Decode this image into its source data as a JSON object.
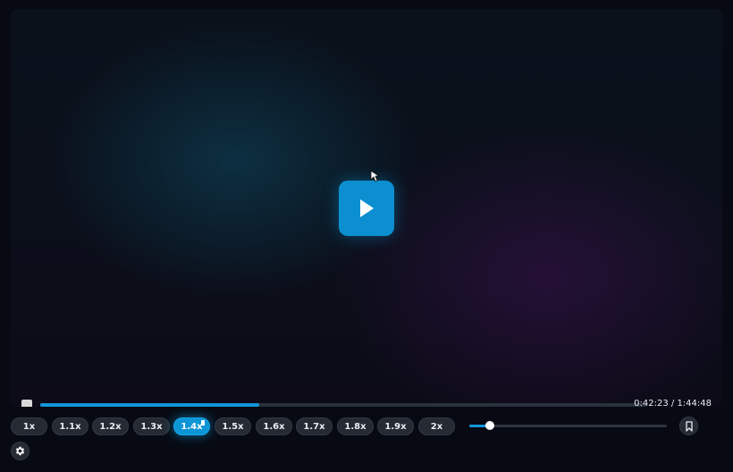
{
  "player": {
    "play_icon": "play-icon",
    "cursor_icon": "mouse-pointer-icon",
    "stop_icon": "stop-icon",
    "progress_fraction": 0.3616,
    "time_display": "0:42:23 / 1:44:48",
    "volume_fraction": 0.105,
    "bookmark_icon": "bookmark-icon",
    "settings_icon": "gear-icon"
  },
  "speeds": [
    {
      "label": "1x",
      "active": false
    },
    {
      "label": "1.1x",
      "active": false
    },
    {
      "label": "1.2x",
      "active": false
    },
    {
      "label": "1.3x",
      "active": false
    },
    {
      "label": "1.4x",
      "active": true
    },
    {
      "label": "1.5x",
      "active": false
    },
    {
      "label": "1.6x",
      "active": false
    },
    {
      "label": "1.7x",
      "active": false
    },
    {
      "label": "1.8x",
      "active": false
    },
    {
      "label": "1.9x",
      "active": false
    },
    {
      "label": "2x",
      "active": false
    }
  ],
  "colors": {
    "accent": "#0b8fd0",
    "background": "#070a12",
    "button": "#252a33"
  }
}
